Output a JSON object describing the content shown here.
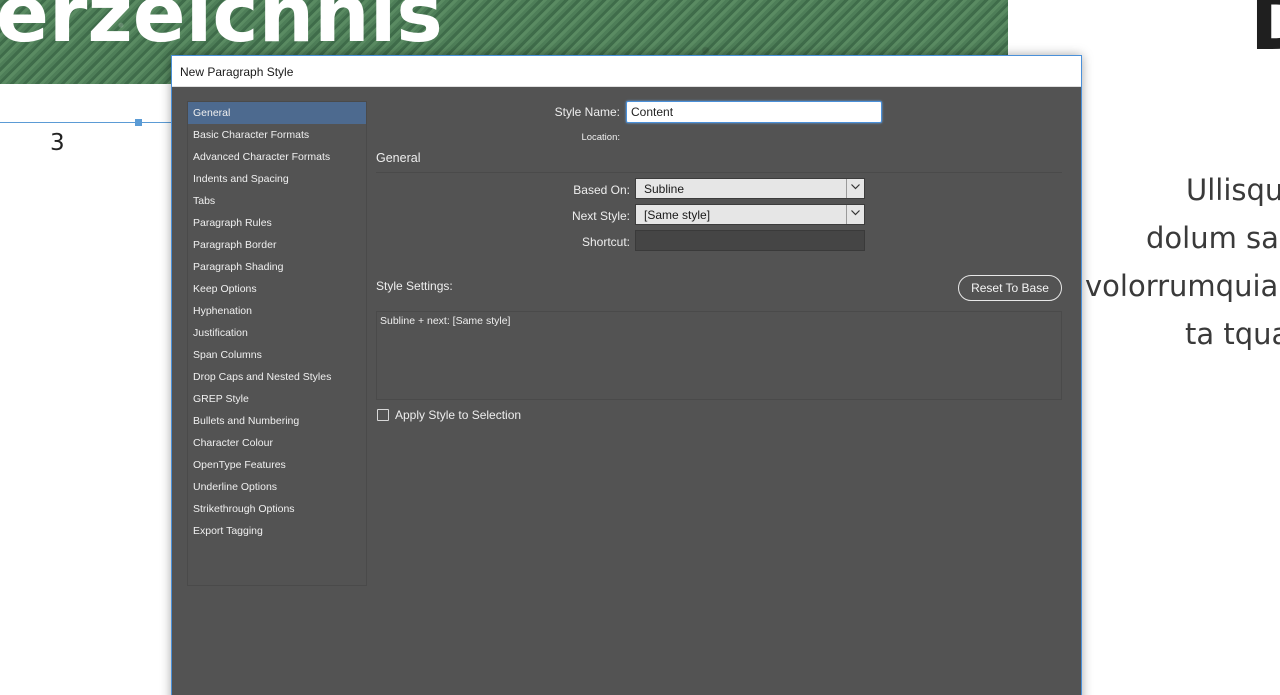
{
  "background": {
    "heading": "erzeichnis",
    "right_letter": "D",
    "page_number": "3",
    "paragraph_lines": [
      "Ullisqu",
      "dolum sa",
      "volorrumquia",
      "ta tqua"
    ]
  },
  "dialog": {
    "title": "New Paragraph Style",
    "categories": [
      {
        "label": "General",
        "selected": true
      },
      {
        "label": "Basic Character Formats"
      },
      {
        "label": "Advanced Character Formats"
      },
      {
        "label": "Indents and Spacing"
      },
      {
        "label": "Tabs"
      },
      {
        "label": "Paragraph Rules"
      },
      {
        "label": "Paragraph Border"
      },
      {
        "label": "Paragraph Shading"
      },
      {
        "label": "Keep Options"
      },
      {
        "label": "Hyphenation"
      },
      {
        "label": "Justification"
      },
      {
        "label": "Span Columns"
      },
      {
        "label": "Drop Caps and Nested Styles"
      },
      {
        "label": "GREP Style"
      },
      {
        "label": "Bullets and Numbering"
      },
      {
        "label": "Character Colour"
      },
      {
        "label": "OpenType Features"
      },
      {
        "label": "Underline Options"
      },
      {
        "label": "Strikethrough Options"
      },
      {
        "label": "Export Tagging"
      }
    ],
    "style_name": {
      "label": "Style Name:",
      "value": "Content"
    },
    "location_label": "Location:",
    "section_title": "General",
    "based_on": {
      "label": "Based On:",
      "value": "Subline"
    },
    "next_style": {
      "label": "Next Style:",
      "value": "[Same style]"
    },
    "shortcut": {
      "label": "Shortcut:",
      "value": ""
    },
    "style_settings_label": "Style Settings:",
    "reset_button": "Reset To Base",
    "style_settings_text": "Subline + next: [Same style]",
    "apply_to_selection": {
      "label": "Apply Style to Selection",
      "checked": false
    }
  }
}
